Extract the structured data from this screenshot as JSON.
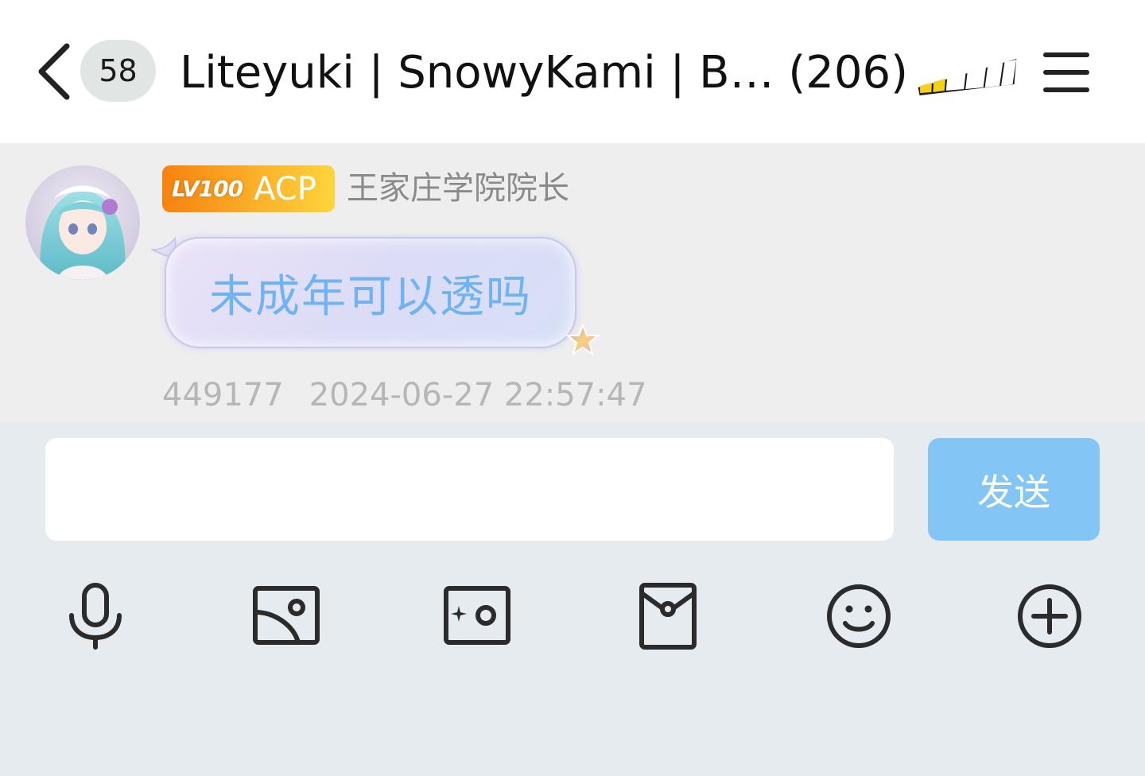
{
  "header": {
    "unread_count": "58",
    "title": "Liteyuki | SnowyKami | B… (206)",
    "icons": {
      "back": "chevron-left-icon",
      "decoration": "hooray-sticker",
      "menu": "hamburger-menu-icon"
    }
  },
  "message": {
    "avatar": "anime-girl-avatar",
    "level_label": "LV100",
    "role_label": "ACP",
    "sender_title": "王家庄学院院长",
    "text": "未成年可以透吗",
    "sender_id": "449177",
    "timestamp": "2024-06-27 22:57:47"
  },
  "input": {
    "value": "",
    "placeholder": "",
    "send_label": "发送"
  },
  "toolbar": {
    "icons": [
      "microphone-icon",
      "image-icon",
      "camera-icon",
      "red-packet-icon",
      "emoji-icon",
      "add-icon"
    ]
  },
  "colors": {
    "header_bg": "#ffffff",
    "message_area_bg": "#eeeeee",
    "input_area_bg": "#e6ebf0",
    "bubble_text": "#6fb3f0",
    "send_button": "#72bff7",
    "level_badge_start": "#f7820e",
    "level_badge_end": "#fdd43a",
    "meta_text": "#b6b6b6"
  }
}
